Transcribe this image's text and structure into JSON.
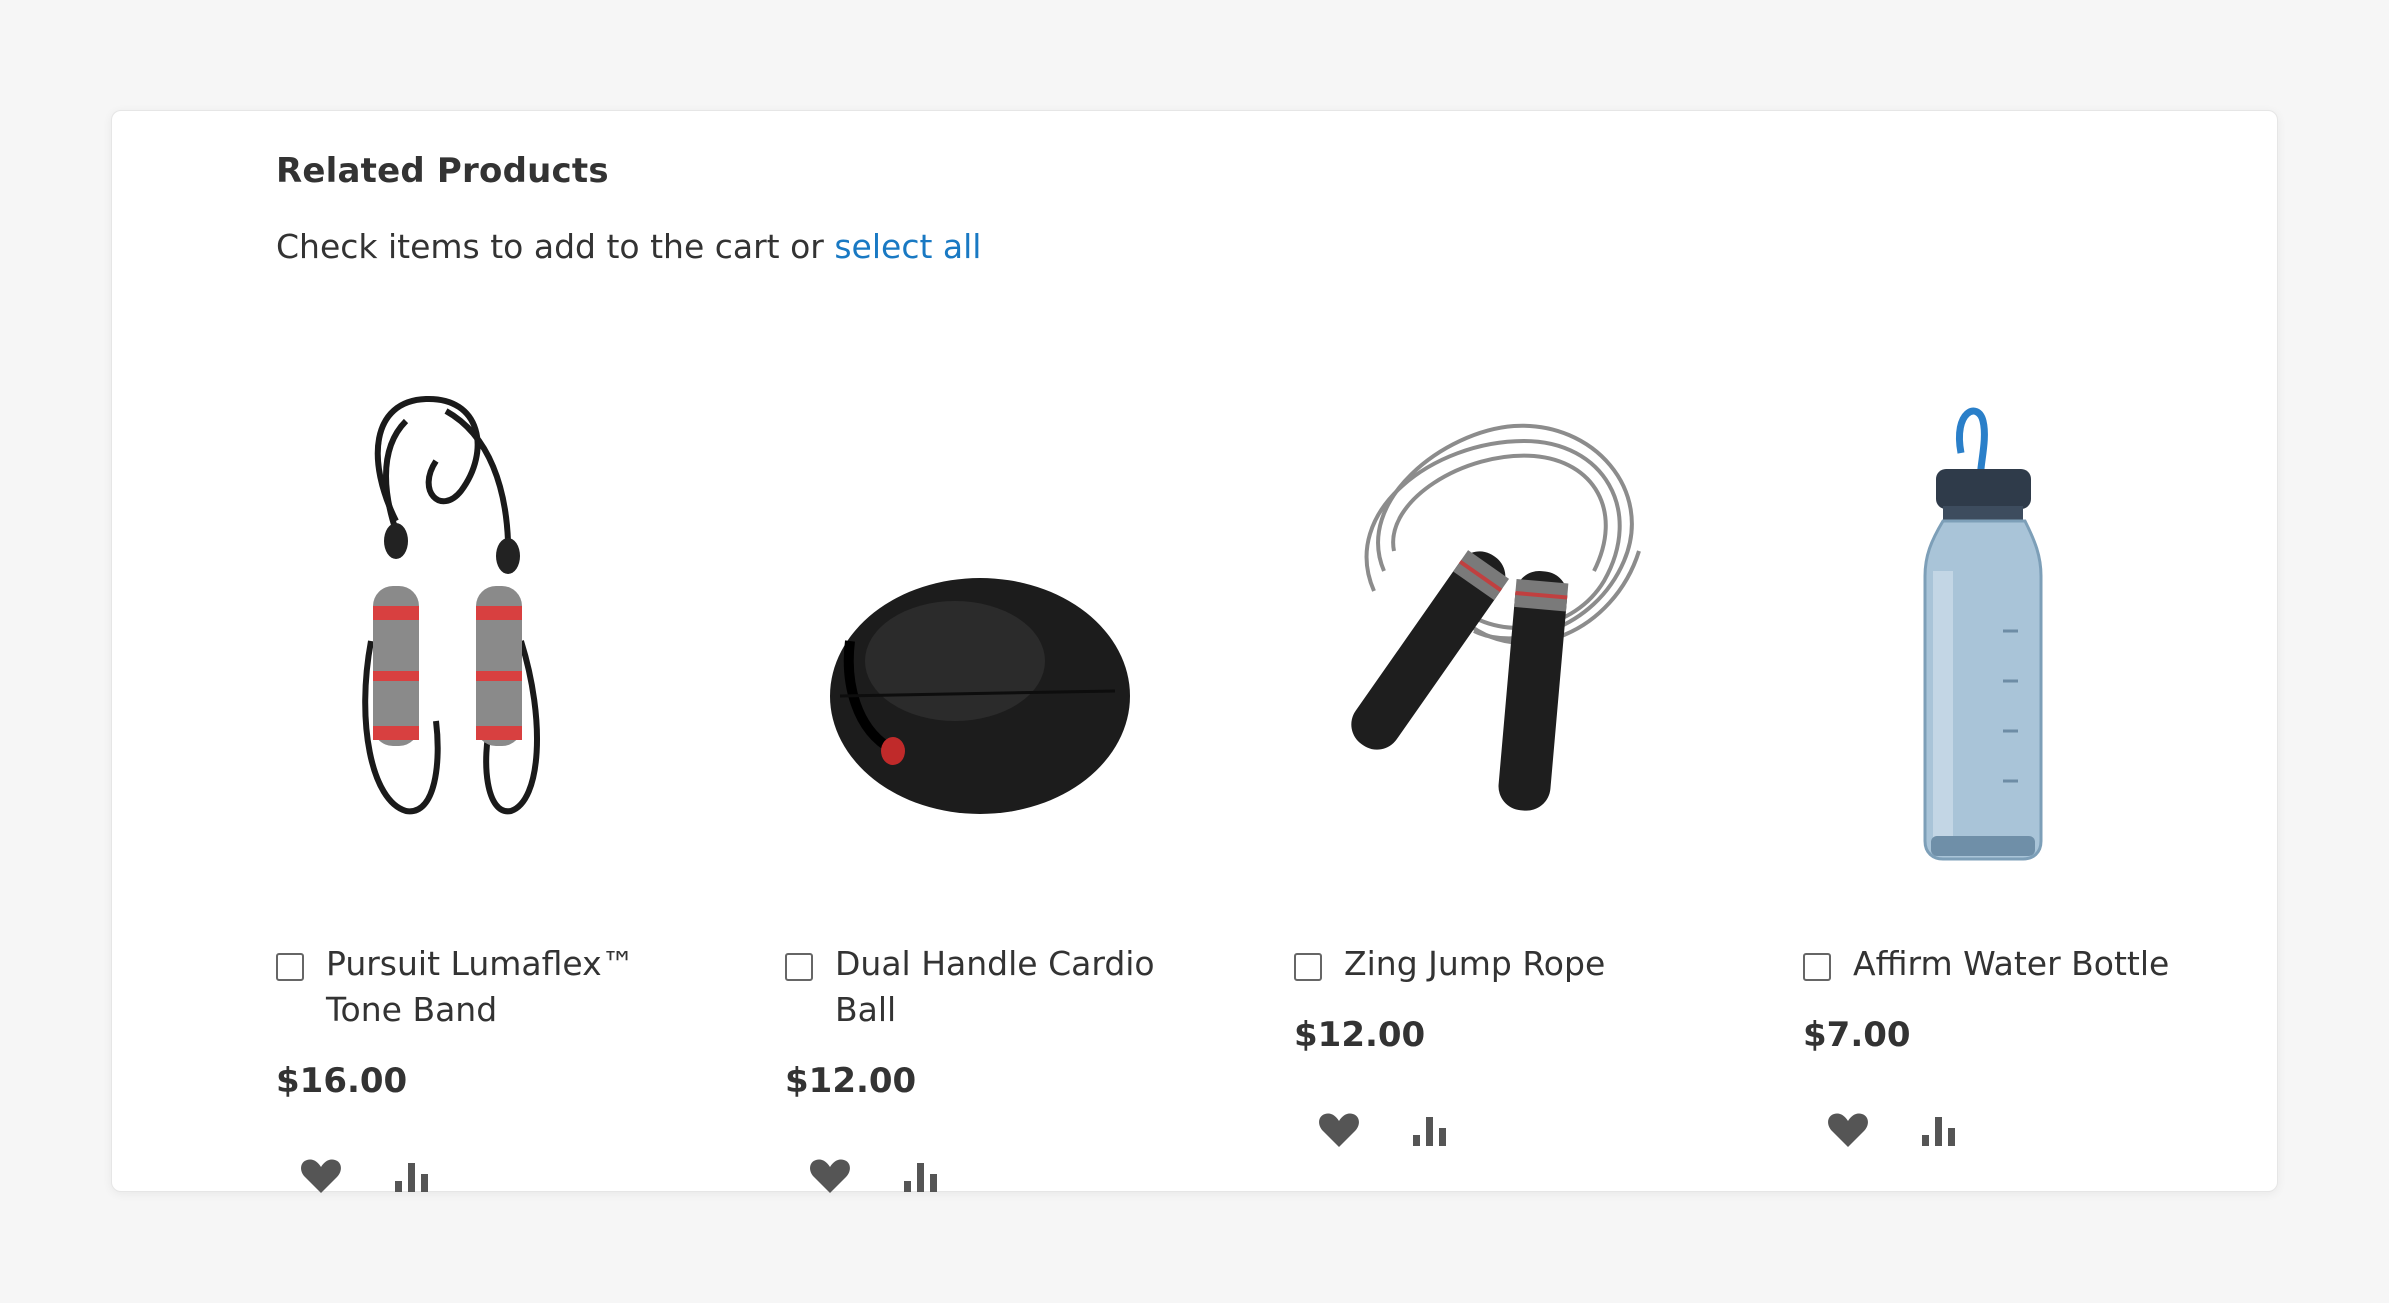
{
  "block": {
    "title": "Related Products",
    "actions_text": "Check items to add to the cart or",
    "select_all_label": "select all"
  },
  "colors": {
    "link": "#1979c3",
    "text": "#333333",
    "icon": "#555555"
  },
  "products": [
    {
      "name": "Pursuit Lumaflex™ Tone Band",
      "price": "$16.00",
      "image": "tone-band",
      "checked": false,
      "wishlist_icon": "heart-icon",
      "compare_icon": "compare-bars-icon"
    },
    {
      "name": "Dual Handle Cardio Ball",
      "price": "$12.00",
      "image": "cardio-ball",
      "checked": false,
      "wishlist_icon": "heart-icon",
      "compare_icon": "compare-bars-icon"
    },
    {
      "name": "Zing Jump Rope",
      "price": "$12.00",
      "image": "jump-rope",
      "checked": false,
      "wishlist_icon": "heart-icon",
      "compare_icon": "compare-bars-icon"
    },
    {
      "name": "Affirm Water Bottle",
      "price": "$7.00",
      "image": "water-bottle",
      "checked": false,
      "wishlist_icon": "heart-icon",
      "compare_icon": "compare-bars-icon"
    }
  ]
}
